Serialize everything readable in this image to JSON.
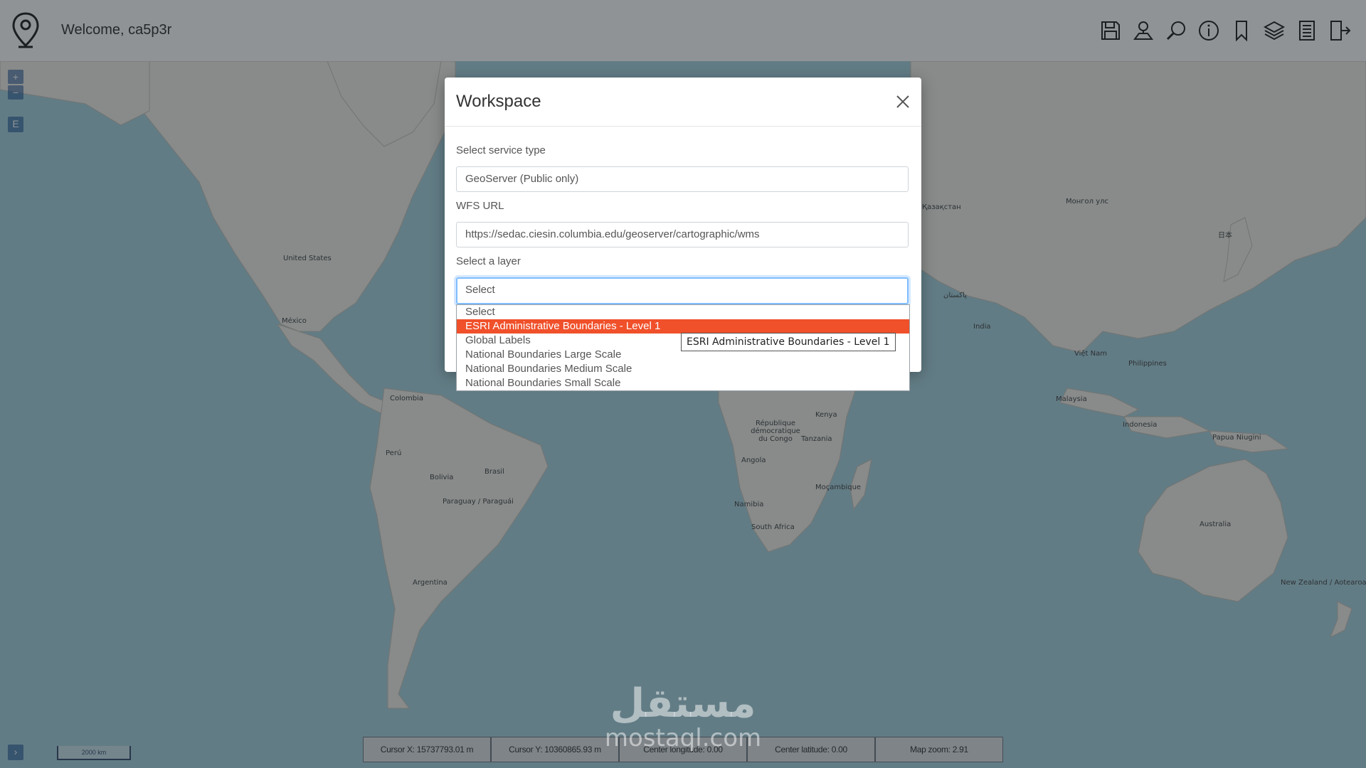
{
  "header": {
    "welcome": "Welcome, ca5p3r",
    "tools": [
      "save-icon",
      "user-location-icon",
      "search-icon",
      "info-icon",
      "bookmark-icon",
      "layers-icon",
      "list-icon",
      "logout-icon"
    ]
  },
  "map_controls": {
    "zoom_in": "+",
    "zoom_out": "−",
    "extent": "E",
    "expand": "›"
  },
  "map_labels": {
    "united_states": "United States",
    "mexico": "México",
    "colombia": "Colombia",
    "peru": "Perú",
    "bolivia": "Bolivia",
    "brasil": "Brasil",
    "paraguay": "Paraguay / Paraguái",
    "argentina": "Argentina",
    "india": "India",
    "pakistan": "پاکستان",
    "kazakhstan": "Қазақстан",
    "mongolia": "Монгол улс",
    "japan": "日本",
    "vietnam": "Việt Nam",
    "philippines": "Philippines",
    "malaysia": "Malaysia",
    "indonesia": "Indonesia",
    "papua": "Papua Niugini",
    "australia": "Australia",
    "new_zealand": "New Zealand / Aotearoa",
    "kenya": "Kenya",
    "tanzania": "Tanzania",
    "drc": "République démocratique du Congo",
    "angola": "Angola",
    "mozambique": "Moçambique",
    "namibia": "Namibia",
    "south_africa": "South Africa"
  },
  "modal": {
    "title": "Workspace",
    "service_label": "Select service type",
    "service_value": "GeoServer (Public only)",
    "wfs_label": "WFS URL",
    "wfs_value": "https://sedac.ciesin.columbia.edu/geoserver/cartographic/wms",
    "layer_label": "Select a layer",
    "layer_value": "Select",
    "layer_options": [
      "Select",
      "ESRI Administrative Boundaries - Level 1",
      "Global Labels",
      "National Boundaries Large Scale",
      "National Boundaries Medium Scale",
      "National Boundaries Small Scale"
    ],
    "selected_index": 1,
    "tooltip": "ESRI Administrative Boundaries - Level 1"
  },
  "status": {
    "cursor_x": "Cursor X: 15737793.01 m",
    "cursor_y": "Cursor Y: 10360865.93 m",
    "center_lon": "Center longitude: 0.00",
    "center_lat": "Center latitude: 0.00",
    "zoom": "Map zoom: 2.91"
  },
  "scale_label": "2000 km",
  "watermark": {
    "arabic": "مستقل",
    "latin": "mostaql.com"
  },
  "colors": {
    "selected_option": "#f0502a",
    "focus_border": "#80bdff",
    "water": "#aad3df",
    "land": "#f2efe9"
  }
}
